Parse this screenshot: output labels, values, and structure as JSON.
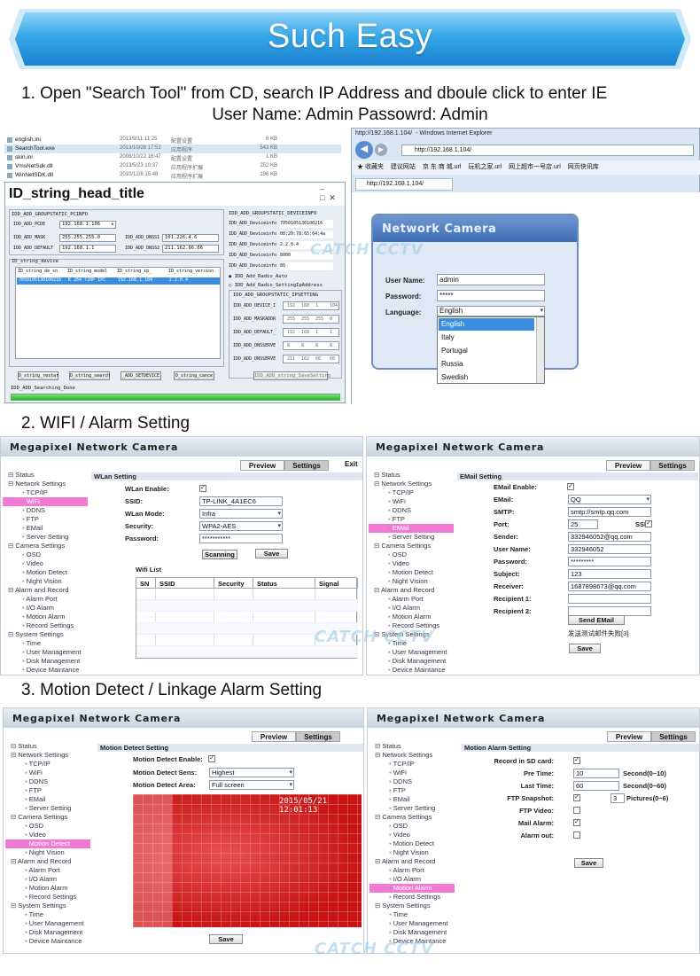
{
  "header": {
    "title": "Such Easy"
  },
  "steps": {
    "s1_line1": "1. Open \"Search Tool\" from CD, search IP Address and dboule click to enter IE",
    "s1_line2": "User Name: Admin  Passowrd: Admin",
    "s2": "2. WIFI / Alarm Setting",
    "s3": "3. Motion Detect / Linkage Alarm Setting"
  },
  "watermark": "CATCH CCTV",
  "files": {
    "rows": [
      {
        "name": "english.ini",
        "date": "2013/9/11 11:25",
        "type": "配置设置",
        "size": "6 KB"
      },
      {
        "name": "SearchTool.exe",
        "date": "2013/10/28 17:52",
        "type": "应用程序",
        "size": "543 KB"
      },
      {
        "name": "skin.ini",
        "date": "2008/10/22 16:47",
        "type": "配置设置",
        "size": "1 KB"
      },
      {
        "name": "VmsNetSdk.dll",
        "date": "2013/5/23 10:37",
        "type": "应用程序扩展",
        "size": "252 KB"
      },
      {
        "name": "WinNetSDK.dll",
        "date": "2010/12/8 15:48",
        "type": "应用程序扩展",
        "size": "196 KB"
      }
    ]
  },
  "search_tool": {
    "title": "ID_string_head_title",
    "group_static": "IDD_ADD_GROUPSTATIC_PCINFO",
    "pc_labels": [
      "IDD_ADD_PCDE",
      "IDD_ADD_MASK",
      "IDD_ADD_DEFAULT"
    ],
    "pc_values": [
      "192.168.1.106",
      "255.255.255.0",
      "192.168.1.1"
    ],
    "dns_labels": [
      "IDD_ADD_DNSS1",
      "IDD_ADD_DNSS2"
    ],
    "dns_values": [
      "101.226.4.6",
      "211.162.66.66"
    ],
    "device_group": "ID_string_device",
    "cols": [
      "ID_string_de_sn",
      "ID_string_model",
      "ID_string_ip_",
      "ID_string_version"
    ],
    "row": [
      "7050105130100216",
      "K 264 720P IPC",
      "192.168.1.104",
      "2.2.0.4"
    ],
    "buttons": [
      "D_string_restar",
      "D_string_search",
      "_ADD_SETDEVICE",
      "D_string_cance"
    ],
    "status": "IDD_ADD_Searching_Done",
    "dev_group": "IDD_ADD_GROUPSTATIC_DEVICEINFO",
    "dev_labels": [
      "IDD_ADD_Deviceinfo",
      "IDD_ADD_Deviceinfo",
      "IDD_ADD_Deviceinfo",
      "IDD_ADD_Deviceinfo",
      "IDD_ADD_Deviceinfo"
    ],
    "dev_values": [
      "7050105130100216",
      "08:20:78:65:64:4a",
      "2.2.0.4",
      "8000",
      "80"
    ],
    "radio1": "IDD_Add_Radio_Auto",
    "radio2": "IDD_Add_Radio_SettingIpAddress",
    "ipset_group": "IDD_ADD_GROUPSTATIC_IPSETTING",
    "ip_labels": [
      "IDD_ADD_DEVICE_I",
      "IDD_ADD_MASKADDR",
      "IDD_ADD_DEFAULT_",
      "IDD_ADD_DNSSERVE",
      "IDD_ADD_DNSSERVE"
    ],
    "ip_values": [
      [
        "192",
        "168",
        "1",
        "104"
      ],
      [
        "255",
        "255",
        "255",
        "0"
      ],
      [
        "192",
        "168",
        "1",
        "1"
      ],
      [
        "8",
        "8",
        "8",
        "8"
      ],
      [
        "211",
        "162",
        "66",
        "66"
      ]
    ],
    "save_btn": "IDD_ADD_string_SaveSetting"
  },
  "ie": {
    "url": "http://192.168.1.104/",
    "title": "- Windows Internet Explorer",
    "favs": "收藏夹",
    "links": [
      "建议网站",
      "京 东 商 城.url",
      "玩机之家.url",
      "网上超市一号店.url",
      "网页快讯库"
    ],
    "tab": "http://192.168.1.104/",
    "login_title": "Network Camera",
    "user_label": "User Name:",
    "user_value": "admin",
    "pass_label": "Password:",
    "pass_value": "*****",
    "lang_label": "Language:",
    "lang_value": "English",
    "lang_options": [
      "English",
      "Italy",
      "Portugal",
      "Russia",
      "Swedish"
    ]
  },
  "cam": {
    "title": "Megapixel Network Camera",
    "preview": "Preview",
    "settings": "Settings",
    "exit": "Exit",
    "menu": [
      {
        "t": "Status",
        "k": "g"
      },
      {
        "t": "Network Settings",
        "k": "g"
      },
      {
        "t": "TCP/IP",
        "k": "c"
      },
      {
        "t": "WiFi",
        "k": "c"
      },
      {
        "t": "DDNS",
        "k": "c"
      },
      {
        "t": "FTP",
        "k": "c"
      },
      {
        "t": "EMail",
        "k": "c"
      },
      {
        "t": "Server Setting",
        "k": "c"
      },
      {
        "t": "Camera Settings",
        "k": "g"
      },
      {
        "t": "OSD",
        "k": "c"
      },
      {
        "t": "Video",
        "k": "c"
      },
      {
        "t": "Motion Detect",
        "k": "c"
      },
      {
        "t": "Night Vision",
        "k": "c"
      },
      {
        "t": "Alarm and Record",
        "k": "g"
      },
      {
        "t": "Alarm Port",
        "k": "c"
      },
      {
        "t": "I/O Alarm",
        "k": "c"
      },
      {
        "t": "Motion Alarm",
        "k": "c"
      },
      {
        "t": "Record Settings",
        "k": "c"
      },
      {
        "t": "System Settings",
        "k": "g"
      },
      {
        "t": "Time",
        "k": "c"
      },
      {
        "t": "User Management",
        "k": "c"
      },
      {
        "t": "Disk Management",
        "k": "c"
      },
      {
        "t": "Device Maintance",
        "k": "c"
      }
    ]
  },
  "wlan": {
    "header": "WLan Setting",
    "enable": "WLan Enable:",
    "ssid_l": "SSID:",
    "ssid": "TP-LINK_4A1EC6",
    "mode_l": "WLan Mode:",
    "mode": "Infra",
    "sec_l": "Security:",
    "sec": "WPA2-AES",
    "pw_l": "Password:",
    "pw": "***********",
    "scan": "Scanning",
    "save": "Save",
    "list": "Wifi List",
    "cols": [
      "SN",
      "SSID",
      "Security",
      "Status",
      "Signal"
    ]
  },
  "email": {
    "header": "EMail Setting",
    "labels": [
      "EMail Enable:",
      "EMail:",
      "SMTP:",
      "Port:",
      "Sender:",
      "User Name:",
      "Password:",
      "Subject:",
      "Receiver:",
      "Recipient 1:",
      "Recipient 2:"
    ],
    "email": "QQ",
    "smtp": "smtp://smtp.qq.com",
    "port": "25",
    "ssl": "SSL",
    "sender": "332946052@qq.com",
    "user": "332946052",
    "pw": "*********",
    "subject": "123",
    "receiver": "1687898673@qq.com",
    "send": "Send EMail",
    "result": "发送测试邮件失败[3]",
    "save": "Save"
  },
  "motion": {
    "header": "Motion Detect Setting",
    "enable": "Motion Detect Enable:",
    "sens_l": "Motion Detect Sens:",
    "sens": "Highest",
    "area_l": "Motion Detect Area:",
    "area": "Full screen",
    "osd": "2015/05/21 12:01:13",
    "save": "Save"
  },
  "malarm": {
    "header": "Motion Alarm Setting",
    "labels": [
      "Record in SD card:",
      "Pre Time:",
      "Last Time:",
      "FTP Snapshot:",
      "FTP Video:",
      "Mail Alarm:",
      "Alarm out:"
    ],
    "pre": "10",
    "pre_u": "Second(0~10)",
    "last": "60",
    "last_u": "Second(0~60)",
    "pics": "3",
    "pics_u": "Pictures(0~6)",
    "save": "Save"
  },
  "colors": {
    "banner": "#2fa6e6",
    "selected": "#f27ad4",
    "motion_red": "#c81414"
  }
}
